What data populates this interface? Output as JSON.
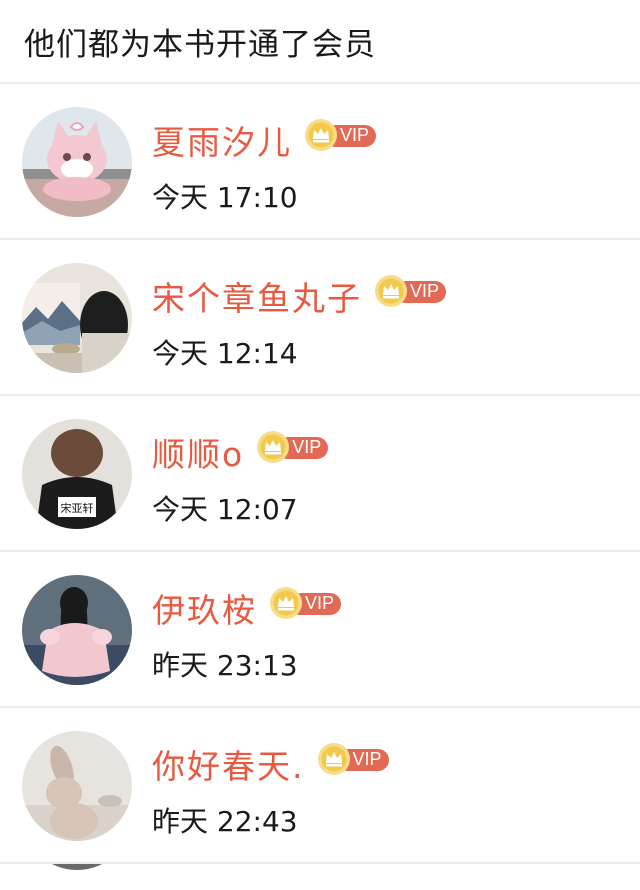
{
  "header": {
    "title": "他们都为本书开通了会员"
  },
  "badge": {
    "vip_label": "VIP",
    "colors": {
      "pill": "#e26a55",
      "crown_fill": "#f2c94c",
      "crown_ring": "#f7dd8a"
    }
  },
  "members": [
    {
      "name": "夏雨汐儿",
      "time": "今天 17:10",
      "avatar": "pink-fox-plush-avatar"
    },
    {
      "name": "宋个章鱼丸子",
      "time": "今天 12:14",
      "avatar": "painting-girl-avatar"
    },
    {
      "name": "顺顺o",
      "time": "今天 12:07",
      "avatar": "black-shirt-avatar"
    },
    {
      "name": "伊玖桉",
      "time": "昨天 23:13",
      "avatar": "pink-dress-girl-avatar"
    },
    {
      "name": "你好春天.",
      "time": "昨天 22:43",
      "avatar": "plush-bunny-avatar"
    }
  ],
  "avatar_text": {
    "shirt_label": "宋亚轩"
  },
  "colors": {
    "name_text": "#e8593f",
    "time_text": "#1a1a1a",
    "divider": "#ececec"
  }
}
